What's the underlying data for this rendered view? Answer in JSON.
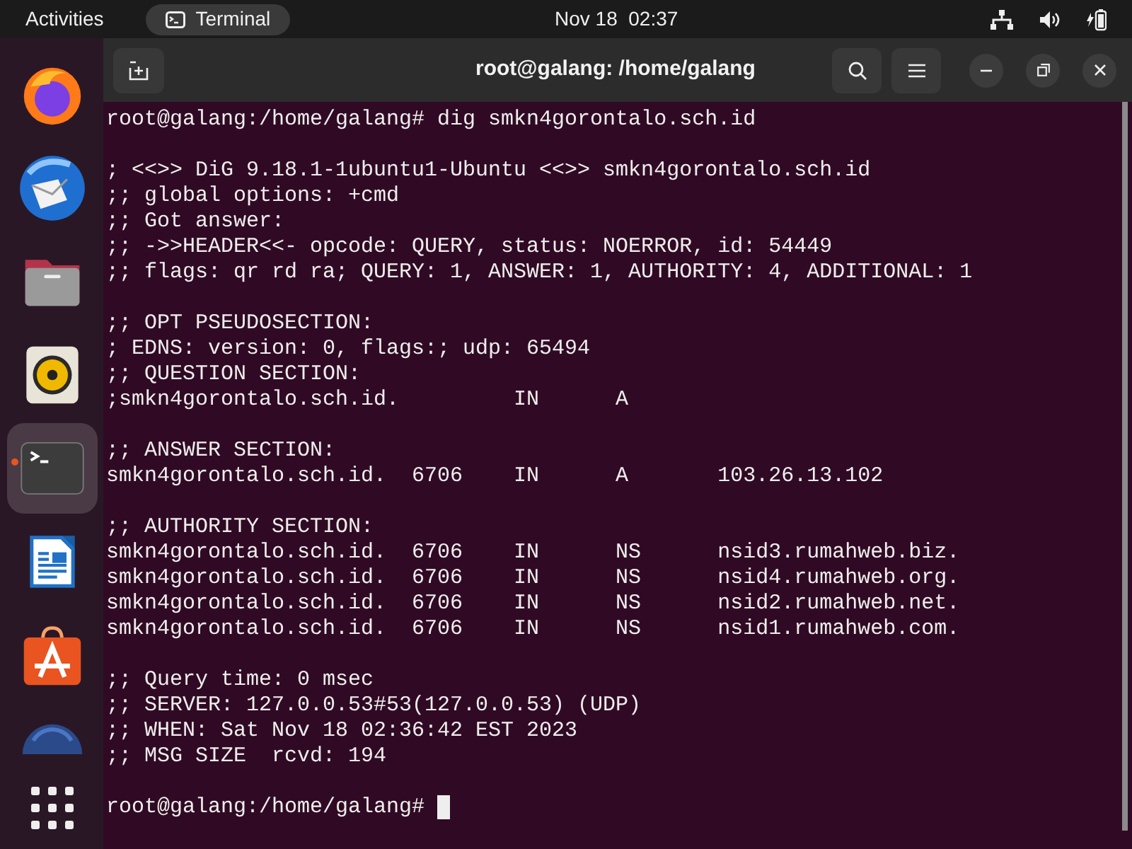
{
  "top_bar": {
    "activities": "Activities",
    "app_label": "Terminal",
    "clock": "Nov 18  02:37"
  },
  "dock": {
    "items": [
      {
        "kind": "browser",
        "selected": false,
        "running": false
      },
      {
        "kind": "mail",
        "selected": false,
        "running": false
      },
      {
        "kind": "files",
        "selected": false,
        "running": false
      },
      {
        "kind": "music",
        "selected": false,
        "running": false
      },
      {
        "kind": "terminal",
        "selected": true,
        "running": true
      },
      {
        "kind": "writer",
        "selected": false,
        "running": false
      },
      {
        "kind": "store",
        "selected": false,
        "running": false
      },
      {
        "kind": "disc",
        "selected": false,
        "running": false
      },
      {
        "kind": "apps",
        "selected": false,
        "running": false
      }
    ]
  },
  "window": {
    "title": "root@galang: /home/galang"
  },
  "terminal": {
    "cursor_visible": true,
    "blocks": [
      [
        "root@galang:/home/galang# dig smkn4gorontalo.sch.id"
      ],
      [
        "; <<>> DiG 9.18.1-1ubuntu1-Ubuntu <<>> smkn4gorontalo.sch.id",
        ";; global options: +cmd",
        ";; Got answer:",
        ";; ->>HEADER<<- opcode: QUERY, status: NOERROR, id: 54449",
        ";; flags: qr rd ra; QUERY: 1, ANSWER: 1, AUTHORITY: 4, ADDITIONAL: 1"
      ],
      [
        ";; OPT PSEUDOSECTION:",
        "; EDNS: version: 0, flags:; udp: 65494",
        ";; QUESTION SECTION:",
        ";smkn4gorontalo.sch.id.         IN      A"
      ],
      [
        ";; ANSWER SECTION:",
        "smkn4gorontalo.sch.id.  6706    IN      A       103.26.13.102"
      ],
      [
        ";; AUTHORITY SECTION:",
        "smkn4gorontalo.sch.id.  6706    IN      NS      nsid3.rumahweb.biz.",
        "smkn4gorontalo.sch.id.  6706    IN      NS      nsid4.rumahweb.org.",
        "smkn4gorontalo.sch.id.  6706    IN      NS      nsid2.rumahweb.net.",
        "smkn4gorontalo.sch.id.  6706    IN      NS      nsid1.rumahweb.com."
      ],
      [
        ";; Query time: 0 msec",
        ";; SERVER: 127.0.0.53#53(127.0.0.53) (UDP)",
        ";; WHEN: Sat Nov 18 02:36:42 EST 2023",
        ";; MSG SIZE  rcvd: 194"
      ],
      [
        "root@galang:/home/galang# "
      ]
    ]
  }
}
